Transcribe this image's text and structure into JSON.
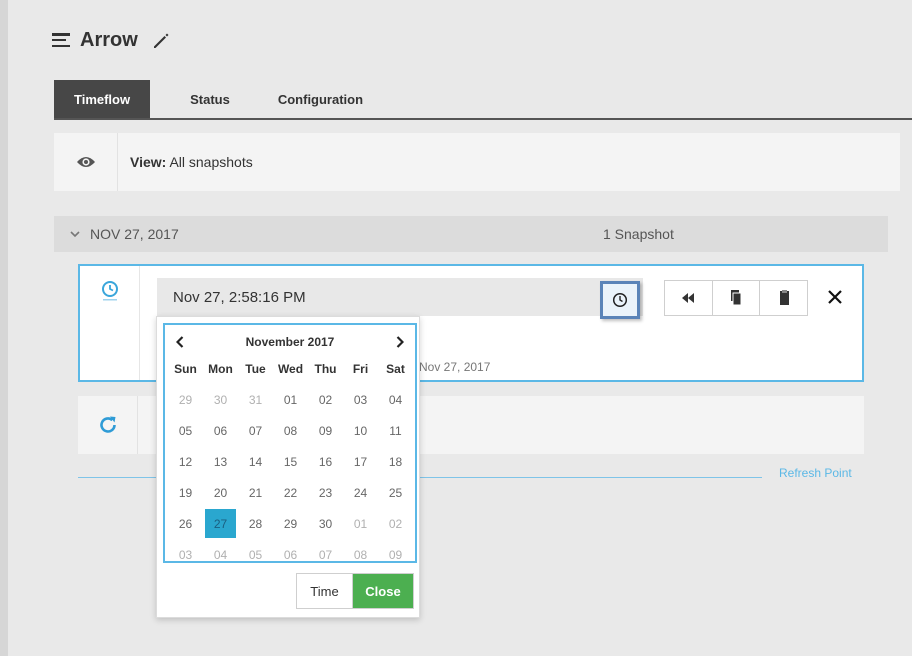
{
  "header": {
    "menu_icon": "hamburger-menu-icon",
    "title": "Arrow",
    "edit_icon": "pencil-icon"
  },
  "tabs": [
    {
      "label": "Timeflow",
      "active": true
    },
    {
      "label": "Status",
      "active": false
    },
    {
      "label": "Configuration",
      "active": false
    }
  ],
  "view": {
    "icon": "eye-icon",
    "label": "View:",
    "value": "All snapshots"
  },
  "group": {
    "date": "NOV 27, 2017",
    "count": "1 Snapshot"
  },
  "snapshot": {
    "time_value": "Nov 27, 2:58:16 PM",
    "date_text": "Nov 27, 2017"
  },
  "refresh": {
    "icon": "refresh-icon",
    "label": "Refresh Point"
  },
  "calendar": {
    "month": "November 2017",
    "weekdays": [
      "Sun",
      "Mon",
      "Tue",
      "Wed",
      "Thu",
      "Fri",
      "Sat"
    ],
    "days": [
      [
        "29",
        "30",
        "31",
        "01",
        "02",
        "03",
        "04"
      ],
      [
        "05",
        "06",
        "07",
        "08",
        "09",
        "10",
        "11"
      ],
      [
        "12",
        "13",
        "14",
        "15",
        "16",
        "17",
        "18"
      ],
      [
        "19",
        "20",
        "21",
        "22",
        "23",
        "24",
        "25"
      ],
      [
        "26",
        "27",
        "28",
        "29",
        "30",
        "01",
        "02"
      ],
      [
        "03",
        "04",
        "05",
        "06",
        "07",
        "08",
        "09"
      ]
    ],
    "selected": "27",
    "time_button": "Time",
    "close_button": "Close"
  },
  "colors": {
    "accent": "#5bb8e6",
    "selected_day": "#2aa7cf",
    "close_button": "#4caf50",
    "active_tab": "#474747"
  }
}
